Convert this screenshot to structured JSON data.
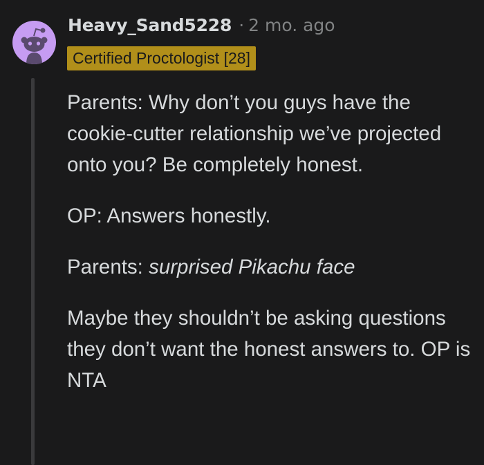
{
  "comment": {
    "author": "Heavy_Sand5228",
    "separator": "·",
    "timestamp": "2 mo. ago",
    "flair": "Certified Proctologist [28]",
    "avatar_icon": "reddit-snoo-avatar-icon",
    "colors": {
      "background": "#1a1a1b",
      "text": "#d7dadc",
      "muted": "#818384",
      "flair_bg": "#b18f1a",
      "avatar_bg": "#c69cf2"
    },
    "paragraphs": {
      "p1": "Parents: Why don’t you guys have the cookie-cutter relationship we’ve projected onto you? Be completely honest.",
      "p2": "OP: Answers honestly.",
      "p3_prefix": "Parents: ",
      "p3_emphasis": "surprised Pikachu face",
      "p4": "Maybe they shouldn’t be asking questions they don’t want the honest answers to. OP is NTA"
    }
  }
}
